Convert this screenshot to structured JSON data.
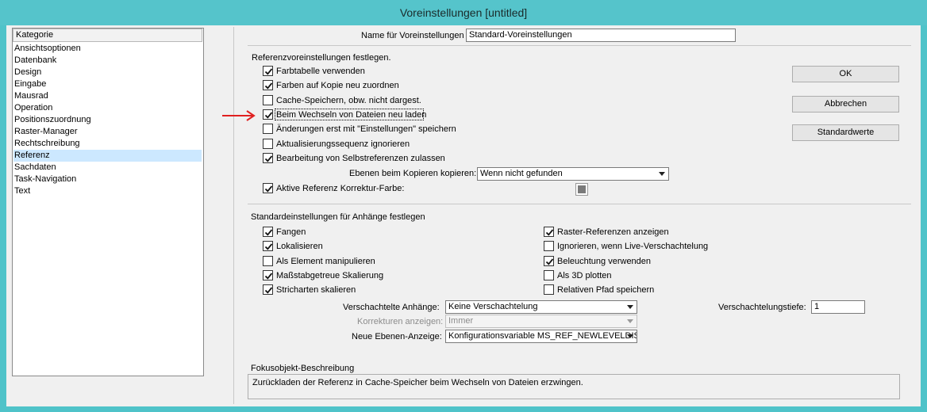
{
  "window": {
    "title": "Voreinstellungen [untitled]"
  },
  "sidebar": {
    "header": "Kategorie",
    "items": [
      "Ansichtsoptionen",
      "Datenbank",
      "Design",
      "Eingabe",
      "Mausrad",
      "Operation",
      "Positionszuordnung",
      "Raster-Manager",
      "Rechtschreibung",
      "Referenz",
      "Sachdaten",
      "Task-Navigation",
      "Text"
    ],
    "selected": "Referenz"
  },
  "preset": {
    "label": "Name für Voreinstellungen",
    "value": "Standard-Voreinstellungen"
  },
  "ref": {
    "section_title": "Referenzvoreinstellungen festlegen.",
    "options": [
      {
        "label": "Farbtabelle verwenden",
        "checked": true
      },
      {
        "label": "Farben auf Kopie neu zuordnen",
        "checked": true
      },
      {
        "label": "Cache-Speichern, obw. nicht dargest.",
        "checked": false
      },
      {
        "label": "Beim Wechseln von Dateien neu laden",
        "checked": true
      },
      {
        "label": "Änderungen erst mit \"Einstellungen\" speichern",
        "checked": false
      },
      {
        "label": "Aktualisierungssequenz ignorieren",
        "checked": false
      },
      {
        "label": "Bearbeitung von Selbstreferenzen zulassen",
        "checked": true
      }
    ],
    "copy_levels_label": "Ebenen beim Kopieren kopieren:",
    "copy_levels_value": "Wenn nicht gefunden",
    "active_ref": {
      "label": "Aktive Referenz Korrektur-Farbe:",
      "checked": true,
      "color": "#7a7a7a"
    }
  },
  "buttons": {
    "ok": "OK",
    "cancel": "Abbrechen",
    "defaults": "Standardwerte"
  },
  "attach": {
    "section_title": "Standardeinstellungen für Anhänge festlegen",
    "left": [
      {
        "label": "Fangen",
        "checked": true
      },
      {
        "label": "Lokalisieren",
        "checked": true
      },
      {
        "label": "Als Element manipulieren",
        "checked": false
      },
      {
        "label": "Maßstabgetreue Skalierung",
        "checked": true
      },
      {
        "label": "Stricharten skalieren",
        "checked": true
      }
    ],
    "right": [
      {
        "label": "Raster-Referenzen anzeigen",
        "checked": true
      },
      {
        "label": "Ignorieren, wenn Live-Verschachtelung",
        "checked": false
      },
      {
        "label": "Beleuchtung verwenden",
        "checked": true
      },
      {
        "label": "Als 3D plotten",
        "checked": false
      },
      {
        "label": "Relativen Pfad speichern",
        "checked": false
      }
    ],
    "nested_label": "Verschachtelte Anhänge:",
    "nested_value": "Keine Verschachtelung",
    "corrections_label": "Korrekturen anzeigen:",
    "corrections_value": "Immer",
    "new_levels_label": "Neue Ebenen-Anzeige:",
    "new_levels_value": "Konfigurationsvariable MS_REF_NEWLEVELDISPLAY",
    "depth_label": "Verschachtelungstiefe:",
    "depth_value": "1"
  },
  "focus": {
    "title": "Fokusobjekt-Beschreibung",
    "text": "Zurückladen der Referenz in Cache-Speicher beim Wechseln von Dateien erzwingen."
  },
  "colors": {
    "titlebar": "#55c4cb",
    "selection": "#cce8ff",
    "arrow": "#e02020"
  }
}
